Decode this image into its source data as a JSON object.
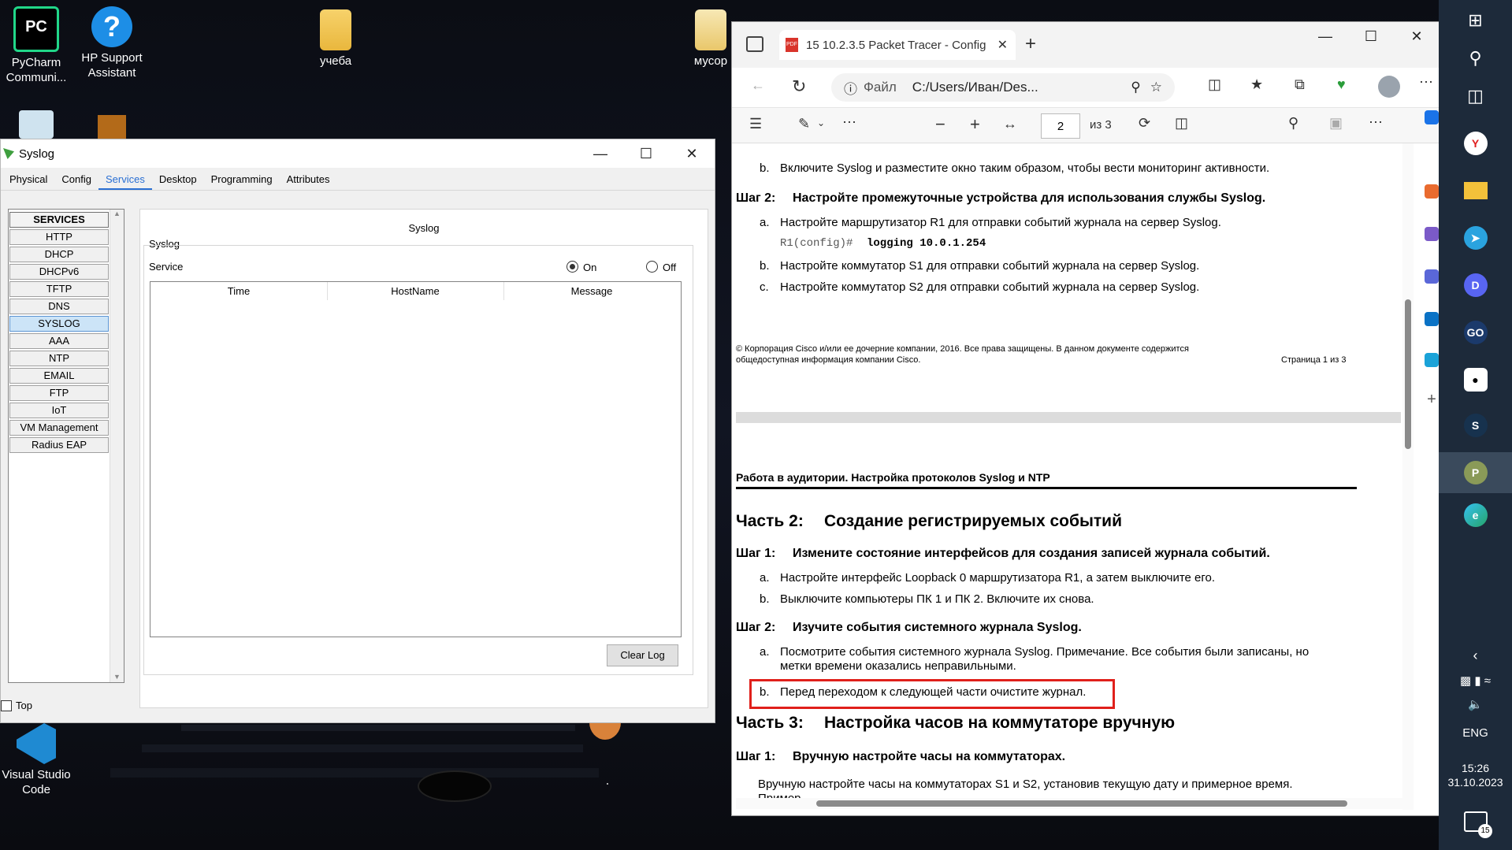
{
  "desktop": {
    "icons": [
      {
        "label1": "PyCharm",
        "label2": "Communi...",
        "icon": "pycharm-icon"
      },
      {
        "label1": "HP Support",
        "label2": "Assistant",
        "icon": "help-icon"
      },
      {
        "label1": "учеба",
        "label2": "",
        "icon": "folder-icon"
      },
      {
        "label1": "мусор",
        "label2": "",
        "icon": "folder-icon"
      },
      {
        "label1": "Visual Studio",
        "label2": "Code",
        "icon": "vscode-icon"
      }
    ]
  },
  "syslog_window": {
    "title": "Syslog",
    "tabs": [
      "Physical",
      "Config",
      "Services",
      "Desktop",
      "Programming",
      "Attributes"
    ],
    "active_tab": "Services",
    "services_header": "SERVICES",
    "services": [
      "HTTP",
      "DHCP",
      "DHCPv6",
      "TFTP",
      "DNS",
      "SYSLOG",
      "AAA",
      "NTP",
      "EMAIL",
      "FTP",
      "IoT",
      "VM Management",
      "Radius EAP"
    ],
    "selected_service": "SYSLOG",
    "panel_title": "Syslog",
    "group_label": "Syslog",
    "service_label": "Service",
    "radio_on": "On",
    "radio_off": "Off",
    "service_state": "On",
    "columns": [
      "Time",
      "HostName",
      "Message"
    ],
    "clear_log": "Clear Log",
    "top_label": "Top"
  },
  "browser": {
    "tab_title": "15 10.2.3.5 Packet Tracer - Config",
    "url_prefix": "Файл",
    "url": "C:/Users/Иван/Des...",
    "page_number": "2",
    "page_total": "из 3",
    "pdf": {
      "line_b_top": "b.",
      "line_b_top_text": "Включите Syslog и разместите окно таким образом, чтобы вести мониторинг активности.",
      "step2_label": "Шаг 2:",
      "step2_title": "Настройте промежуточные устройства для использования службы Syslog.",
      "s2a_marker": "a.",
      "s2a_text": "Настройте маршрутизатор R1 для отправки событий журнала на сервер Syslog.",
      "cmd_prompt": "R1(config)#",
      "cmd": "logging 10.0.1.254",
      "s2b_marker": "b.",
      "s2b_text": "Настройте коммутатор S1 для отправки событий журнала на сервер Syslog.",
      "s2c_marker": "c.",
      "s2c_text": "Настройте коммутатор S2 для отправки событий журнала на сервер Syslog.",
      "footer_line1": "© Корпорация Cisco и/или ее дочерние компании, 2016. Все права защищены. В данном документе содержится",
      "footer_line2": "общедоступная информация компании Cisco.",
      "footer_page": "Страница 1 из 3",
      "header2": "Работа в аудитории. Настройка протоколов Syslog и NTP",
      "part2_label": "Часть 2:",
      "part2_title": "Создание регистрируемых событий",
      "p2s1_label": "Шаг 1:",
      "p2s1_title": "Измените состояние интерфейсов для создания записей журнала событий.",
      "p2s1a_marker": "a.",
      "p2s1a_text": "Настройте интерфейс Loopback 0 маршрутизатора R1, а затем выключите его.",
      "p2s1b_marker": "b.",
      "p2s1b_text": "Выключите компьютеры ПК 1 и ПК 2. Включите их снова.",
      "p2s2_label": "Шаг 2:",
      "p2s2_title": "Изучите события системного журнала Syslog.",
      "p2s2a_marker": "a.",
      "p2s2a_text1": "Посмотрите события системного журнала Syslog. Примечание. Все события были записаны, но",
      "p2s2a_text2": "метки времени оказались неправильными.",
      "p2s2b_marker": "b.",
      "p2s2b_text": "Перед переходом к следующей части очистите журнал.",
      "part3_label": "Часть 3:",
      "part3_title": "Настройка часов на коммутаторе вручную",
      "p3s1_label": "Шаг 1:",
      "p3s1_title": "Вручную настройте часы на коммутаторах.",
      "p3_text1": "Вручную настройте часы на коммутаторах S1 и S2, установив текущую дату и примерное время.",
      "p3_text2": "Пример."
    }
  },
  "taskbar": {
    "language": "ENG",
    "time": "15:26",
    "date": "31.10.2023",
    "notifications": "15"
  },
  "colors": {
    "accent": "#2a6fd3",
    "highlight_box": "#e0201b",
    "taskbar": "#1d2a3a"
  }
}
